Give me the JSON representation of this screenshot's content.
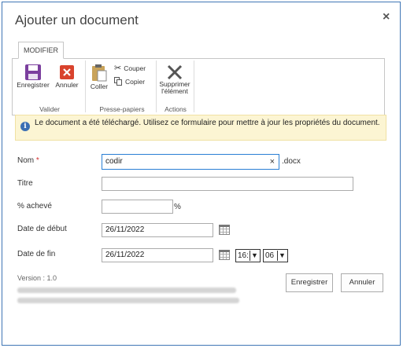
{
  "dialog": {
    "title": "Ajouter un document",
    "close": "×"
  },
  "ribbon": {
    "tab": "MODIFIER",
    "groups": {
      "valider": {
        "label": "Valider",
        "save": "Enregistrer",
        "cancel": "Annuler"
      },
      "clipboard": {
        "label": "Presse-papiers",
        "paste": "Coller",
        "cut": "Couper",
        "copy": "Copier"
      },
      "actions": {
        "label": "Actions",
        "delete_line1": "Supprimer",
        "delete_line2": "l'élément"
      }
    }
  },
  "info": {
    "icon": "i",
    "message": "Le document a été téléchargé. Utilisez ce formulaire pour mettre à jour les propriétés du document."
  },
  "form": {
    "name": {
      "label": "Nom",
      "required": "*",
      "value": "codir",
      "suffix": ".docx",
      "clear": "×"
    },
    "title": {
      "label": "Titre",
      "value": ""
    },
    "percent": {
      "label": "% achevé",
      "value": "",
      "suffix": "%"
    },
    "start_date": {
      "label": "Date de début",
      "value": "26/11/2022"
    },
    "end_date": {
      "label": "Date de fin",
      "value": "26/11/2022",
      "hour": "16:",
      "minute": "06"
    }
  },
  "footer": {
    "version": "Version : 1.0",
    "save": "Enregistrer",
    "cancel": "Annuler"
  },
  "colors": {
    "border": "#3f76b5",
    "info_bg": "#fcf5d3",
    "save_icon": "#7b3f9e",
    "cancel_icon": "#d9432d"
  }
}
